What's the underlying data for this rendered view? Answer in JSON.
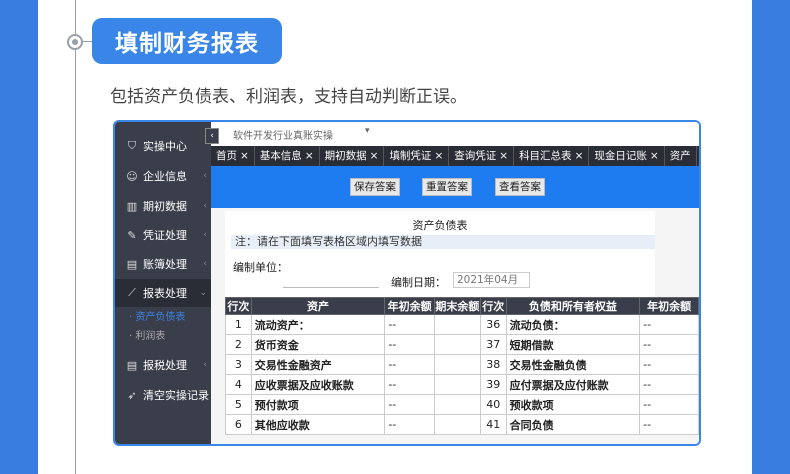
{
  "header": {
    "title": "填制财务报表",
    "subtitle": "包括资产负债表、利润表，支持自动判断正误。"
  },
  "sidebar": {
    "items": [
      {
        "label": "实操中心",
        "icon": "shield-icon"
      },
      {
        "label": "企业信息",
        "icon": "users-icon"
      },
      {
        "label": "期初数据",
        "icon": "bar-chart-icon"
      },
      {
        "label": "凭证处理",
        "icon": "edit-icon"
      },
      {
        "label": "账簿处理",
        "icon": "book-icon"
      },
      {
        "label": "报表处理",
        "icon": "line-chart-icon"
      },
      {
        "label": "报税处理",
        "icon": "book-icon"
      },
      {
        "label": "清空实操记录",
        "icon": "rocket-icon"
      }
    ],
    "subitems": [
      {
        "label": "资产负债表"
      },
      {
        "label": "利润表"
      }
    ]
  },
  "topbar": {
    "company": "软件开发行业真账实操"
  },
  "tabs": [
    {
      "label": "首页"
    },
    {
      "label": "基本信息"
    },
    {
      "label": "期初数据"
    },
    {
      "label": "填制凭证"
    },
    {
      "label": "查询凭证"
    },
    {
      "label": "科目汇总表"
    },
    {
      "label": "现金日记账"
    },
    {
      "label": "资产"
    }
  ],
  "tab_close": "×",
  "toolbar": {
    "save_label": "保存答案",
    "reset_label": "重置答案",
    "view_label": "查看答案"
  },
  "sheet": {
    "title": "资产负债表",
    "note": "注：请在下面填写表格区域内填写数据",
    "unit_label": "编制单位：",
    "date_label": "编制日期：",
    "date_value": "2021年04月"
  },
  "table": {
    "headers": [
      "行次",
      "资产",
      "年初余额",
      "期末余额",
      "行次",
      "负债和所有者权益",
      "年初余额"
    ],
    "rows": [
      {
        "n1": "1",
        "a": "流动资产：",
        "b1": "--",
        "n2": "36",
        "l": "流动负债：",
        "b2": "--"
      },
      {
        "n1": "2",
        "a": "货币资金",
        "b1": "--",
        "n2": "37",
        "l": "短期借款",
        "b2": "--"
      },
      {
        "n1": "3",
        "a": "交易性金融资产",
        "b1": "--",
        "n2": "38",
        "l": "交易性金融负债",
        "b2": "--"
      },
      {
        "n1": "4",
        "a": "应收票据及应收账款",
        "b1": "--",
        "n2": "39",
        "l": "应付票据及应付账款",
        "b2": "--"
      },
      {
        "n1": "5",
        "a": "预付款项",
        "b1": "--",
        "n2": "40",
        "l": "预收款项",
        "b2": "--"
      },
      {
        "n1": "6",
        "a": "其他应收款",
        "b1": "--",
        "n2": "41",
        "l": "合同负债",
        "b2": "--"
      }
    ]
  }
}
